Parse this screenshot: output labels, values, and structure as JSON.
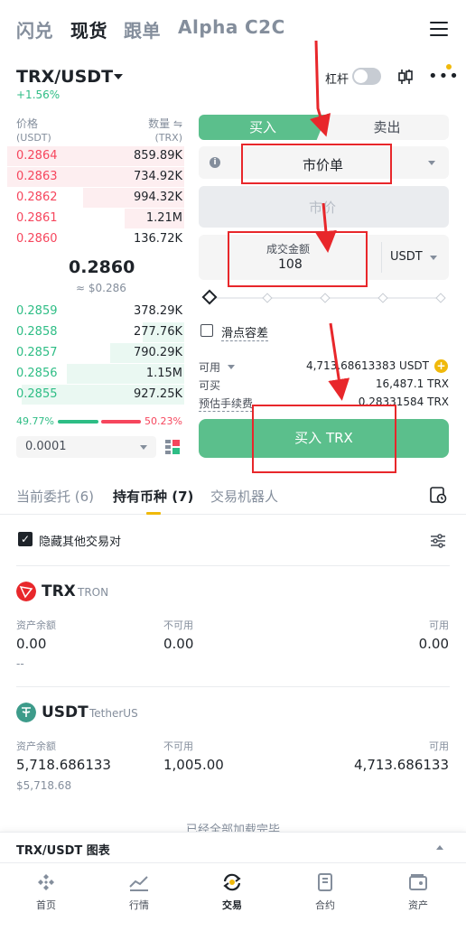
{
  "top_nav": {
    "tabs": [
      "闪兑",
      "现货",
      "跟单",
      "Alpha",
      "C2C"
    ],
    "active": "现货"
  },
  "pair": {
    "symbol": "TRX/USDT",
    "change": "+1.56%",
    "leverage_label": "杠杆"
  },
  "orderbook": {
    "price_header": "价格",
    "price_unit": "(USDT)",
    "qty_header": "数量 ⇋",
    "qty_unit": "(TRX)",
    "asks": [
      {
        "price": "0.2864",
        "qty": "859.89K"
      },
      {
        "price": "0.2863",
        "qty": "734.92K"
      },
      {
        "price": "0.2862",
        "qty": "994.32K"
      },
      {
        "price": "0.2861",
        "qty": "1.21M"
      },
      {
        "price": "0.2860",
        "qty": "136.72K"
      }
    ],
    "mid_price": "0.2860",
    "mid_usd": "≈ $0.286",
    "bids": [
      {
        "price": "0.2859",
        "qty": "378.29K"
      },
      {
        "price": "0.2858",
        "qty": "277.76K"
      },
      {
        "price": "0.2857",
        "qty": "790.29K"
      },
      {
        "price": "0.2856",
        "qty": "1.15M"
      },
      {
        "price": "0.2855",
        "qty": "927.25K"
      }
    ],
    "buy_ratio": "49.77%",
    "sell_ratio": "50.23%",
    "precision": "0.0001"
  },
  "form": {
    "buy_tab": "买入",
    "sell_tab": "卖出",
    "order_type": "市价单",
    "price_placeholder": "市价",
    "amount_label": "成交金额",
    "amount_value": "108",
    "amount_unit": "USDT",
    "slippage_label": "滑点容差",
    "available_label": "可用",
    "available_value": "4,713.68613383 USDT",
    "can_buy_label": "可买",
    "can_buy_value": "16,487.1 TRX",
    "fee_label": "预估手续费",
    "fee_value": "0.28331584 TRX",
    "submit": "买入 TRX"
  },
  "bottom_tabs": {
    "open_orders": "当前委托 (6)",
    "holdings": "持有币种 (7)",
    "bots": "交易机器人"
  },
  "hide_others": "隐藏其他交易对",
  "holdings": [
    {
      "symbol": "TRX",
      "name": "TRON",
      "balance_label": "资产余额",
      "balance": "0.00",
      "balance_sub": "--",
      "frozen_label": "不可用",
      "frozen": "0.00",
      "available_label": "可用",
      "available": "0.00"
    },
    {
      "symbol": "USDT",
      "name": "TetherUS",
      "balance_label": "资产余额",
      "balance": "5,718.686133",
      "balance_sub": "$5,718.68",
      "frozen_label": "不可用",
      "frozen": "1,005.00",
      "available_label": "可用",
      "available": "4,713.686133"
    }
  ],
  "loaded_text": "已经全部加载完毕",
  "chart_bar_label": "TRX/USDT 图表",
  "tabbar": [
    "首页",
    "行情",
    "交易",
    "合约",
    "资产"
  ],
  "colors": {
    "buy": "#5bbf8c",
    "sell": "#f6465d",
    "brand": "#f0b90b",
    "annotation": "#e8272b"
  }
}
